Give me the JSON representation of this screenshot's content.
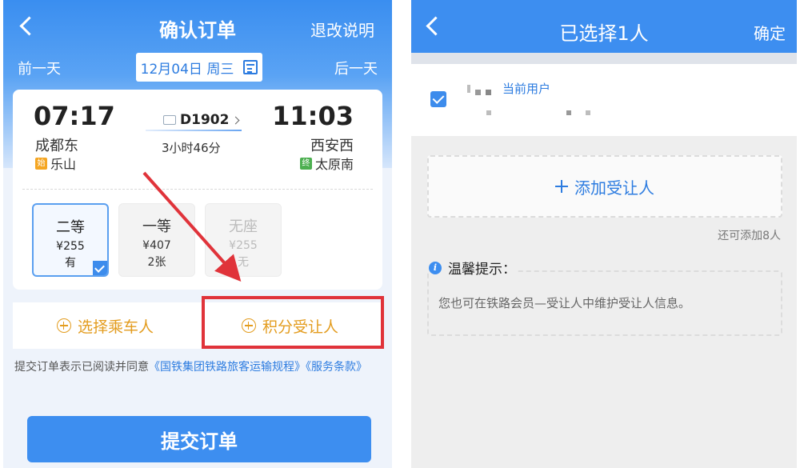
{
  "left_screen": {
    "header": {
      "title": "确认订单",
      "refund_label": "退改说明"
    },
    "date_bar": {
      "prev_label": "前一天",
      "date": "12月04日 周三",
      "next_label": "后一天"
    },
    "train": {
      "number": "D1902",
      "departure_time": "07:17",
      "departure_station": "成都东",
      "departure_origin_badge": "始",
      "departure_origin": "乐山",
      "arrival_time": "11:03",
      "arrival_station": "西安西",
      "arrival_terminal_badge": "终",
      "arrival_terminal": "太原南",
      "duration": "3小时46分"
    },
    "seats": [
      {
        "name": "二等",
        "price": "¥255",
        "availability": "有",
        "selected": true
      },
      {
        "name": "一等",
        "price": "¥407",
        "availability": "2张",
        "selected": false
      },
      {
        "name": "无座",
        "price": "¥255",
        "availability": "无",
        "selected": false
      }
    ],
    "actions": {
      "select_passenger": "选择乘车人",
      "points_beneficiary": "积分受让人"
    },
    "terms": {
      "prefix": "提交订单表示已阅读并同意",
      "link1": "《国铁集团铁路旅客运输规程》",
      "link2": "《服务条款》"
    },
    "submit_label": "提交订单",
    "colors": {
      "primary": "#3d8ef0",
      "accent_orange": "#e39c1e",
      "annotation_red": "#e0333a"
    }
  },
  "right_screen": {
    "header": {
      "title": "已选择1人",
      "confirm_label": "确定"
    },
    "current_user_label": "当前用户",
    "add_label": "添加受让人",
    "remaining_text": "还可添加8人",
    "tip_title": "温馨提示：",
    "tip_text": "您也可在铁路会员—受让人中维护受让人信息。"
  }
}
